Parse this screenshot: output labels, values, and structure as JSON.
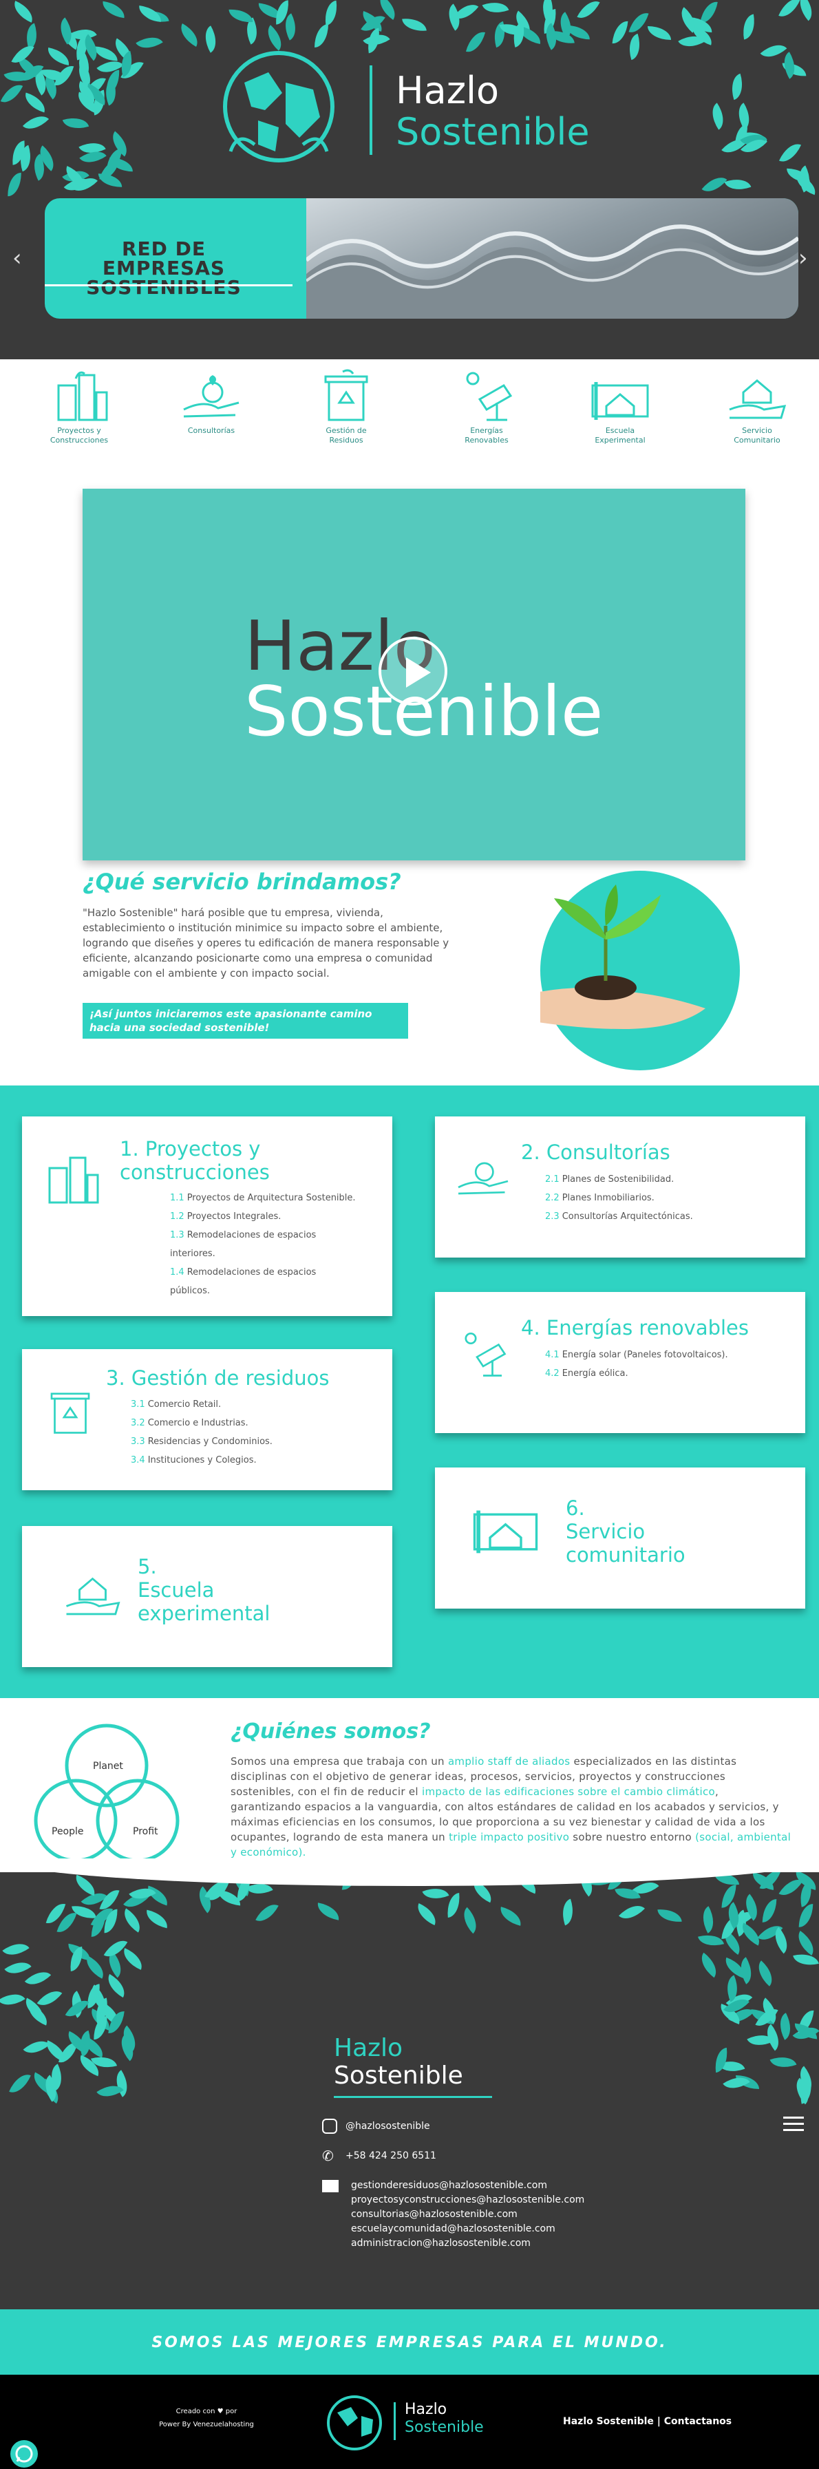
{
  "brand": {
    "hazlo": "Hazlo",
    "sostenible": "Sostenible",
    "teal": "#2fd3c2",
    "dark": "#3a3a3a"
  },
  "slider": {
    "text_line1": "RED DE EMPRESAS",
    "text_line2": "SOSTENIBLES",
    "prev_icon": "chevron-left-icon",
    "next_icon": "chevron-right-icon"
  },
  "categories": [
    {
      "label_l1": "Proyectos y",
      "label_l2": "Construcciones",
      "icon": "buildings-icon"
    },
    {
      "label_l1": "Consultorías",
      "label_l2": "",
      "icon": "hand-plant-icon"
    },
    {
      "label_l1": "Gestión de",
      "label_l2": "Residuos",
      "icon": "recycle-bin-icon"
    },
    {
      "label_l1": "Energías",
      "label_l2": "Renovables",
      "icon": "solar-panel-icon"
    },
    {
      "label_l1": "Escuela",
      "label_l2": "Experimental",
      "icon": "school-house-icon"
    },
    {
      "label_l1": "Servicio",
      "label_l2": "Comunitario",
      "icon": "hand-house-icon"
    }
  ],
  "video": {
    "title_l1": "Hazlo",
    "title_l2": "Sostenible",
    "play_icon": "play-icon"
  },
  "services_intro": {
    "title": "¿Qué servicio brindamos?",
    "text": "\"Hazlo Sostenible\" hará posible que tu empresa, vivienda, establecimiento o institución minimice su impacto sobre el ambiente, logrando que diseñes y operes tu edificación de manera responsable y eficiente, alcanzando posicionarte como una empresa o comunidad amigable con el ambiente y con impacto social.",
    "cta_l1": "¡Así juntos iniciaremos este apasionante camino",
    "cta_l2": "hacia una sociedad sostenible!"
  },
  "services": [
    {
      "title_l1": "1. Proyectos y",
      "title_l2": "construcciones",
      "icon": "buildings-icon",
      "items": [
        {
          "num": "1.1",
          "text": "Proyectos de Arquitectura Sostenible."
        },
        {
          "num": "1.2",
          "text": "Proyectos Integrales."
        },
        {
          "num": "1.3",
          "text": "Remodelaciones de espacios"
        },
        {
          "num": "",
          "text": "interiores."
        },
        {
          "num": "1.4",
          "text": "Remodelaciones de espacios"
        },
        {
          "num": "",
          "text": "públicos."
        }
      ]
    },
    {
      "title_l1": "2. Consultorías",
      "title_l2": "",
      "icon": "hand-plant-icon",
      "items": [
        {
          "num": "2.1",
          "text": "Planes de Sostenibilidad."
        },
        {
          "num": "2.2",
          "text": "Planes Inmobiliarios."
        },
        {
          "num": "2.3",
          "text": "Consultorías Arquitectónicas."
        }
      ]
    },
    {
      "title_l1": "3. Gestión de residuos",
      "title_l2": "",
      "icon": "recycle-bin-icon",
      "items": [
        {
          "num": "3.1",
          "text": "Comercio Retail."
        },
        {
          "num": "3.2",
          "text": "Comercio e Industrias."
        },
        {
          "num": "3.3",
          "text": "Residencias y Condominios."
        },
        {
          "num": "3.4",
          "text": "Instituciones y Colegios."
        }
      ]
    },
    {
      "title_l1": "4. Energías renovables",
      "title_l2": "",
      "icon": "solar-panel-icon",
      "items": [
        {
          "num": "4.1",
          "text": "Energía solar (Paneles fotovoltaicos)."
        },
        {
          "num": "4.2",
          "text": "Energía eólica."
        }
      ]
    },
    {
      "title_l1": "5.",
      "title_l2": "Escuela",
      "title_l3": "experimental",
      "icon": "hand-house-icon",
      "items": []
    },
    {
      "title_l1": "6.",
      "title_l2": "Servicio",
      "title_l3": "comunitario",
      "icon": "school-house-icon",
      "items": []
    }
  ],
  "about": {
    "title": "¿Quiénes somos?",
    "p1": "Somos una empresa que trabaja con un ",
    "h1": "amplio staff de aliados",
    "p2": " especializados en las distintas disciplinas con el objetivo de generar ideas, procesos, servicios, proyectos y construcciones sostenibles, con el fin de reducir el ",
    "h2": "impacto de las edificaciones sobre el cambio climático",
    "p3": ", garantizando espacios a la vanguardia, con altos estándares de calidad en los acabados y servicios, y máximas eficiencias en los consumos, lo que proporciona a su vez bienestar y calidad de vida a los ocupantes, logrando de esta manera un ",
    "h3": "triple impacto positivo",
    "p4": " sobre nuestro entorno ",
    "h4": "(social, ambiental y económico).",
    "venn": {
      "planet": "Planet",
      "people": "People",
      "profit": "Profit"
    }
  },
  "footer": {
    "brand_l1": "Hazlo",
    "brand_l2": "Sostenible",
    "instagram": "@hazlosostenible",
    "phone": "+58 424 250 6511",
    "emails": [
      "gestionderesiduos@hazlosostenible.com",
      "proyectosyconstrucciones@hazlosostenible.com",
      "consultorias@hazlosostenible.com",
      "escuelaycomunidad@hazlosostenible.com",
      "administracion@hazlosostenible.com"
    ],
    "banner": "SOMOS LAS MEJORES EMPRESAS PARA EL MUNDO.",
    "made_with": "Creado con ♥ por",
    "powered": "Power By Venezuelahosting",
    "links": "Hazlo Sostenible | Contactanos"
  }
}
